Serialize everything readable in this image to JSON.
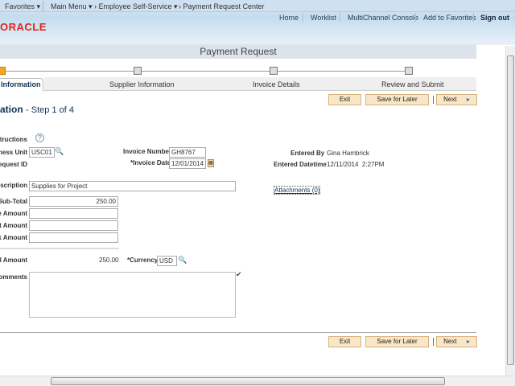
{
  "nav": {
    "favorites": "Favorites",
    "main_menu": "Main Menu",
    "breadcrumb": [
      "Employee Self-Service",
      "Payment Request Center"
    ]
  },
  "header_links": [
    "Home",
    "Worklist",
    "MultiChannel Console",
    "Add to Favorites",
    "Sign out"
  ],
  "logo": "ORACLE",
  "page_title": "Payment Request",
  "steps": [
    {
      "label": "Information",
      "active": true
    },
    {
      "label": "Supplier Information"
    },
    {
      "label": "Invoice Details"
    },
    {
      "label": "Review and Submit"
    }
  ],
  "colors": {
    "active_step": "#f5a623",
    "button_bg": "#f9e6c6",
    "title_bar": "#dde3ea"
  },
  "buttons": {
    "exit": "Exit",
    "save": "Save for Later",
    "next": "Next"
  },
  "heading": {
    "title": "ation",
    "step": "- Step 1 of 4"
  },
  "form": {
    "instructions": "structions",
    "business_unit": {
      "label": "iness Unit",
      "value": "USC01"
    },
    "request_id": {
      "label": "equest ID"
    },
    "invoice_number": {
      "label": "Invoice Number",
      "value": "GH8767"
    },
    "invoice_date": {
      "label": "*Invoice Date",
      "value": "12/01/2014"
    },
    "entered_by": {
      "label": "Entered By",
      "value": "Gina Hambrick"
    },
    "entered_datetime": {
      "label": "Entered Datetime",
      "value": "12/11/2014  2:27PM"
    },
    "description": {
      "label": "escription",
      "value": "Supplies for Project"
    },
    "attachments": "Attachments (0)",
    "sub_total": {
      "label": "Sub-Total",
      "value": "250.00"
    },
    "amount1": {
      "label": "e Amount",
      "value": ""
    },
    "amount2": {
      "label": "nt Amount",
      "value": ""
    },
    "amount3": {
      "label": "x Amount",
      "value": ""
    },
    "total": {
      "label": "al Amount",
      "value": "250.00"
    },
    "currency": {
      "label": "*Currency",
      "value": "USD"
    },
    "comments": {
      "label": "omments",
      "value": ""
    }
  }
}
